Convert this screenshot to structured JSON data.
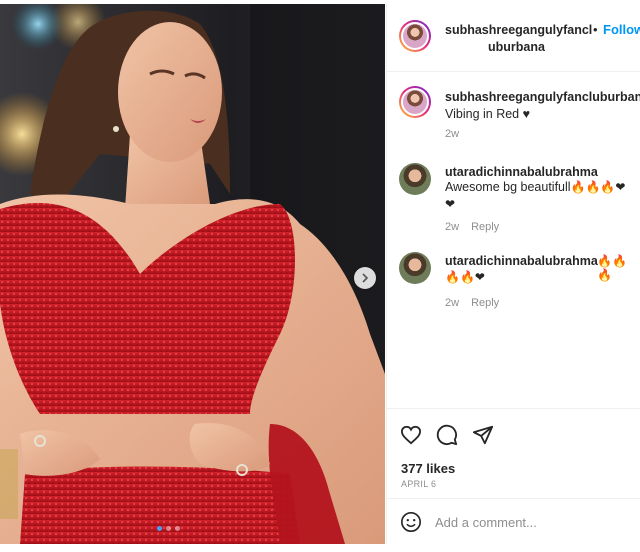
{
  "post": {
    "author": "subhashreegangulyfanclubburbana",
    "header_handle_line1": "subhashreegangulyfancl",
    "header_handle_line2": "uburbana",
    "separator": "•",
    "follow_label": "Follow",
    "caption_author": "subhashreegangulyfancluburbana",
    "caption_text": "Vibing in Red ♥",
    "caption_time": "2w",
    "likes": "377 likes",
    "date": "APRIL 6",
    "carousel_index": 1,
    "carousel_total": 3
  },
  "comments": [
    {
      "author": "utaradichinnabalubrahma",
      "text": "Awesome bg beautifull",
      "emojis_line1": "🔥🔥🔥❤",
      "emojis_line2": "❤",
      "time": "2w",
      "reply_label": "Reply"
    },
    {
      "author": "utaradichinnabalubrahma",
      "emojis_line1": "🔥🔥🔥",
      "emojis_line2": "🔥🔥❤",
      "time": "2w",
      "reply_label": "Reply"
    }
  ],
  "composer": {
    "placeholder": "Add a comment..."
  },
  "icons": {
    "like": "heart-icon",
    "comment": "comment-icon",
    "share": "send-icon",
    "emoji": "emoji-icon",
    "next": "chevron-right-icon"
  },
  "colors": {
    "follow": "#0095f6",
    "meta": "#8e8e8e",
    "dress": "#c4161c"
  }
}
